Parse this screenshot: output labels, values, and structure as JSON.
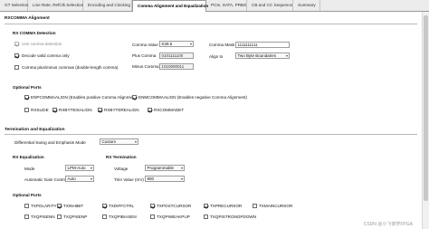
{
  "tabs": [
    {
      "label": "GT Selection"
    },
    {
      "label": "Line Rate, RefClk Selection"
    },
    {
      "label": "Encoding and Clocking"
    },
    {
      "label": "Comma Alignment and Equalization"
    },
    {
      "label": "PCIe, SATA, PRBS"
    },
    {
      "label": "CB and CC Sequence"
    },
    {
      "label": "Summary"
    }
  ],
  "rx_comma": {
    "title": "RXCOMMA Alignment",
    "detection_title": "RX COMMA Detection",
    "use_comma_detection": "Use comma detection",
    "decode_valid_comma": "Decode valid comma only",
    "comma_plus_minus": "Comma plus/minus commas (double-length comma)",
    "comma_value_label": "Comma Value",
    "comma_value": "K28.5",
    "plus_comma_label": "Plus Comma",
    "plus_comma": "0101111100",
    "minus_comma_label": "Minus Comma",
    "minus_comma": "1010000011",
    "comma_mask_label": "Comma Mask",
    "comma_mask": "1111111111",
    "align_to_label": "Align to",
    "align_to": "Two Byte Boundaries"
  },
  "optional_ports_1": {
    "title": "Optional Ports",
    "enpcomma": "ENPCOMMAALIGN (Enables positive Comma Alignment)",
    "enmcomma": "ENMCOMMAALIGN (Enables negative Comma Alignment)",
    "rxslide": "RXSLIDE",
    "rxbytesalign": "RXBYTEISALIGN",
    "rxbyterealign": "RXBYTEREALIGN",
    "rxcommadet": "RXCOMMADET"
  },
  "termination": {
    "title": "Termination and Equalization",
    "diff_swing_label": "Differential Swing and Emphasis Mode",
    "diff_swing_value": "Custom",
    "rx_eq_title": "RX Equalization",
    "mode_label": "Mode",
    "mode_value": "LPM-Auto",
    "agc_label": "Automatic Gain Control",
    "agc_value": "Auto",
    "rx_term_title": "RX Termination",
    "voltage_label": "Voltage",
    "voltage_value": "Programmable",
    "trim_label": "Trim Value (mV)",
    "trim_value": "800"
  },
  "optional_ports_2": {
    "title": "Optional Ports",
    "row1": [
      "TXPOLARITY",
      "TXINHIBIT",
      "TXDIFFCTRL",
      "TXPOSTCURSOR",
      "TXPRECURSOR",
      "TXMAINCURSOR"
    ],
    "row2": [
      "TXQPISENN",
      "TXQPISENP",
      "TXQPIBIASEN",
      "TXQPIWEAKPUP",
      "TXQPISTRONGPDOWN"
    ]
  },
  "watermark": "CSDN @小飞侠学FPGA"
}
